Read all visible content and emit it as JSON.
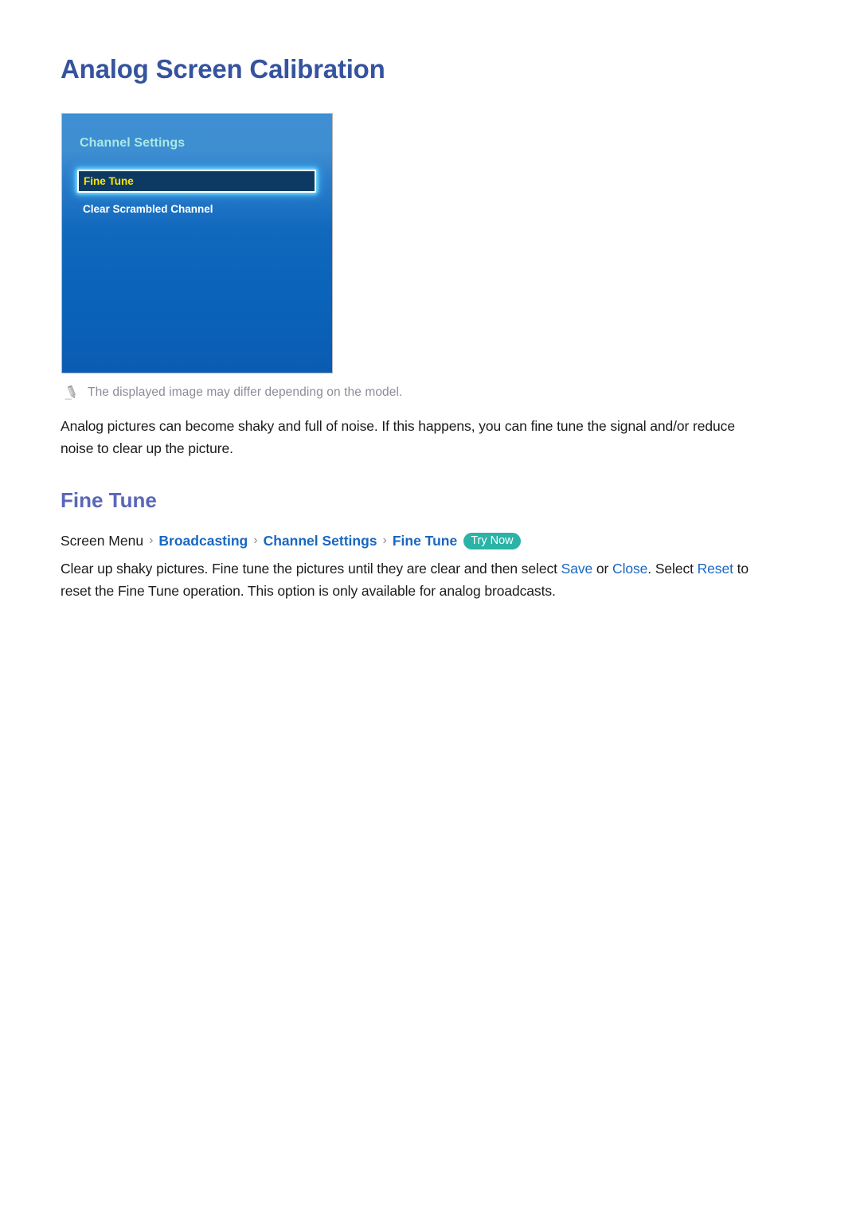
{
  "page": {
    "title": "Analog Screen Calibration"
  },
  "tv_screenshot": {
    "menu_title": "Channel Settings",
    "items": [
      {
        "label": "Fine Tune",
        "selected": true
      },
      {
        "label": "Clear Scrambled Channel",
        "selected": false
      }
    ],
    "colors": {
      "panel_top": "#3f8fd2",
      "panel_bottom": "#0a5cb2",
      "menu_title_text": "#a9e9e3",
      "selected_fill": "#0d3a63",
      "selected_text": "#ffe500",
      "selected_border": "#ffffff",
      "item_text": "#ffffff"
    }
  },
  "note": {
    "icon": "pencil-icon",
    "text": "The displayed image may differ depending on the model."
  },
  "intro_paragraph": "Analog pictures can become shaky and full of noise. If this happens, you can fine tune the signal and/or reduce noise to clear up the picture.",
  "section": {
    "heading": "Fine Tune",
    "breadcrumb": {
      "root": "Screen Menu",
      "separator": "›",
      "links": [
        "Broadcasting",
        "Channel Settings",
        "Fine Tune"
      ],
      "badge": "Try Now",
      "badge_color": "#2ab3a6"
    },
    "detail_parts": {
      "p1": "Clear up shaky pictures. Fine tune the pictures until they are clear and then select ",
      "link_save": "Save",
      "p2": " or ",
      "link_close": "Close",
      "p3": ". Select ",
      "link_reset": "Reset",
      "p4": " to reset the Fine Tune operation. This option is only available for analog broadcasts."
    }
  },
  "colors": {
    "page_title": "#35539e",
    "section_title": "#5a67b8",
    "link_blue": "#1867c0",
    "note_gray": "#8c8c96",
    "body_text": "#1c1c1c"
  }
}
